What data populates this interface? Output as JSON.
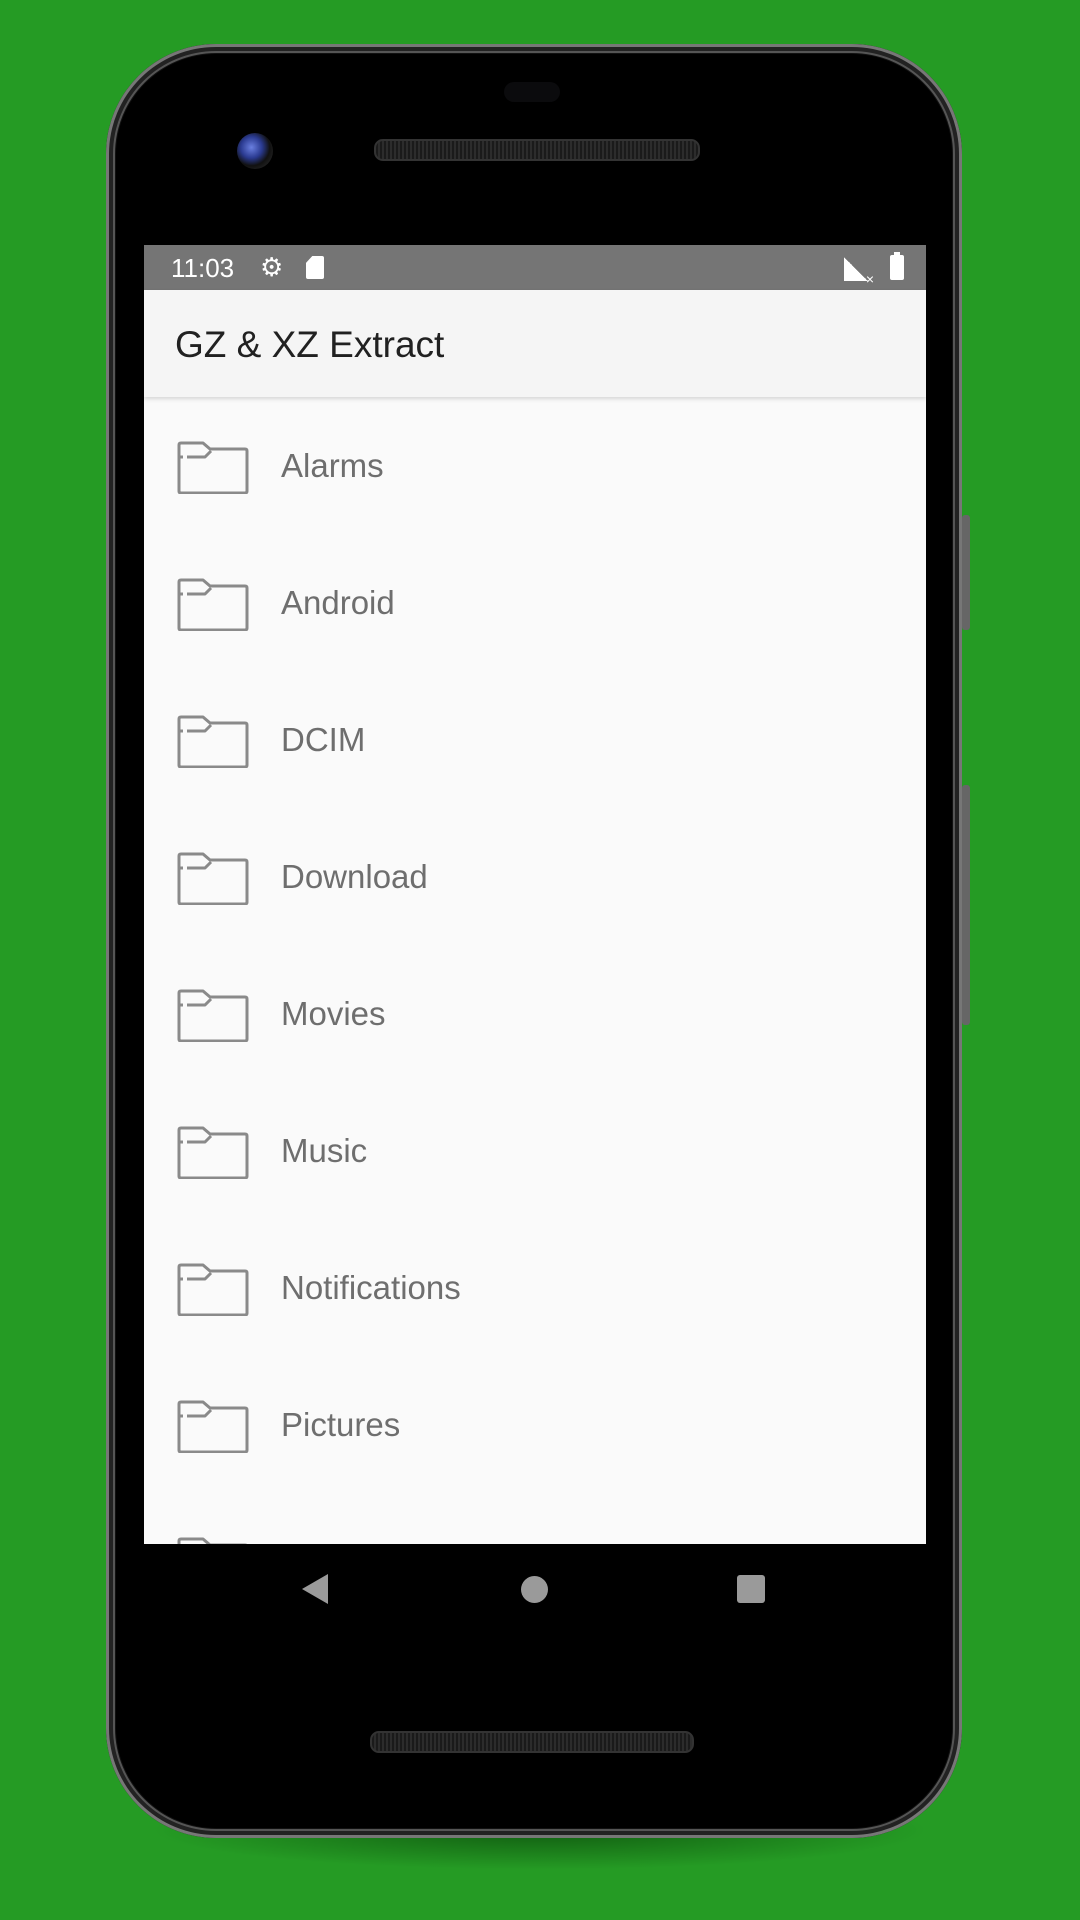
{
  "colors": {
    "background": "#259b24",
    "status_bar": "#757575",
    "app_bar": "#f5f5f5",
    "list_background": "#fafafa",
    "title_text": "#212121",
    "item_text": "#6e6e6e",
    "icon_gray": "#8a8a8a"
  },
  "status_bar": {
    "time": "11:03",
    "icons": [
      "gear-icon",
      "sd-card-icon",
      "signal-no-sim-icon",
      "battery-icon"
    ]
  },
  "app_bar": {
    "title": "GZ & XZ Extract"
  },
  "folders": [
    {
      "label": "Alarms",
      "icon": "folder-icon"
    },
    {
      "label": "Android",
      "icon": "folder-icon"
    },
    {
      "label": "DCIM",
      "icon": "folder-icon"
    },
    {
      "label": "Download",
      "icon": "folder-icon"
    },
    {
      "label": "Movies",
      "icon": "folder-icon"
    },
    {
      "label": "Music",
      "icon": "folder-icon"
    },
    {
      "label": "Notifications",
      "icon": "folder-icon"
    },
    {
      "label": "Pictures",
      "icon": "folder-icon"
    },
    {
      "label": "",
      "icon": "folder-icon"
    }
  ],
  "nav_bar": {
    "buttons": [
      "back",
      "home",
      "recents"
    ]
  }
}
